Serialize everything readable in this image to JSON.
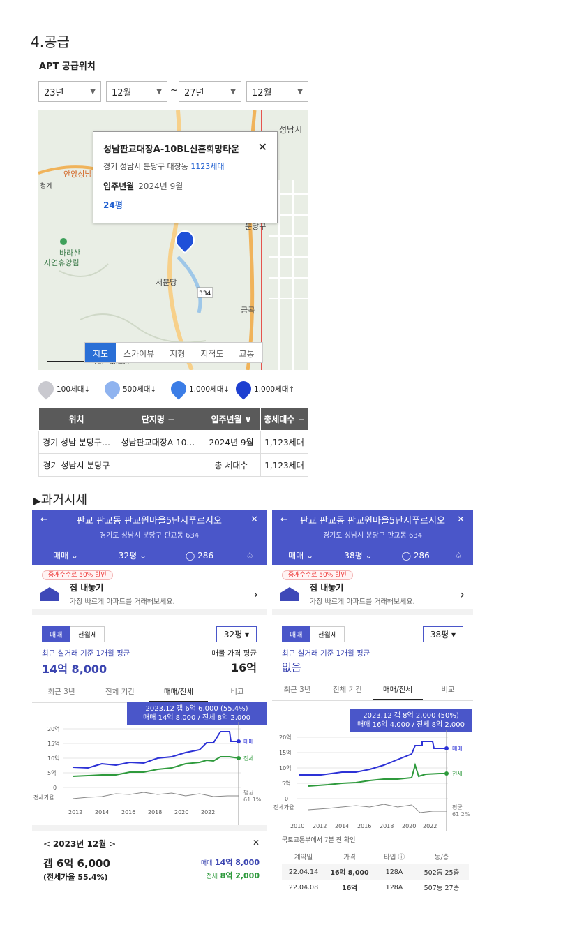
{
  "section1": {
    "title": "4.공급",
    "subtitle": "APT 공급위치"
  },
  "filters": {
    "from_year": "23년",
    "from_month": "12월",
    "tilde": "~",
    "to_year": "27년",
    "to_month": "12월"
  },
  "map": {
    "labels": {
      "seongnam": "성남시",
      "ansung": "안양성남",
      "cheonggye": "청계",
      "barasan": "바라산",
      "forest": "자연휴양림",
      "bundang_gu": "분당구",
      "seobundang": "서분당",
      "route": "334",
      "geumgok": "금곡",
      "scale": "2km",
      "kakao": "Kakao"
    },
    "popup": {
      "title": "성남판교대장A-10BL신혼희망타운",
      "close": "✕",
      "address": "경기 성남시 분당구 대장동",
      "households": "1123세대",
      "move_label": "입주년월",
      "move_value": "2024년 9월",
      "pyeong": "24평"
    },
    "tabs": [
      "지도",
      "스카이뷰",
      "지형",
      "지적도",
      "교통"
    ]
  },
  "legend": [
    "100세대↓",
    "500세대↓",
    "1,000세대↓",
    "1,000세대↑"
  ],
  "supply_table": {
    "headers": [
      "위치",
      "단지명 −",
      "입주년월 ∨",
      "총세대수 −"
    ],
    "rows": [
      [
        "경기 성남 분당구…",
        "성남판교대장A-10…",
        "2024년 9월",
        "1,123세대"
      ],
      [
        "경기 성남시 분당구",
        "",
        "총 세대수",
        "1,123세대"
      ]
    ]
  },
  "section2": {
    "title": "과거시세"
  },
  "left_panel": {
    "back": "←",
    "title": "판교 판교동 판교원마을5단지푸르지오",
    "close": "✕",
    "address": "경기도 성남시 분당구 판교동 634",
    "trade": "매매",
    "pyeong": "32평",
    "comments": "286",
    "promo": "중개수수료 50% 할인",
    "house_title": "집 내놓기",
    "house_sub": "가장 빠르게 아파트를 거래해보세요.",
    "chip_sale": "매매",
    "chip_rent": "전월세",
    "pysel": "32평",
    "avg_label": "최근 실거래 기준 1개월 평균",
    "avg_value": "14억 8,000",
    "ask_label": "매물 가격 평균",
    "ask_value": "16억",
    "tabs": [
      "최근 3년",
      "전체 기간",
      "매매/전세",
      "비교"
    ],
    "tip1": "2023.12  갭 6억 6,000 (55.4%)",
    "tip2": "매매 14억 8,000 / 전세 8억 2,000",
    "yticks": [
      "20억",
      "15억",
      "10억",
      "5억",
      "0"
    ],
    "rate_label": "전세가율",
    "xticks": [
      "2012",
      "2014",
      "2016",
      "2018",
      "2020",
      "2022"
    ],
    "line_sale": "매매",
    "line_jeonse": "전세",
    "rate_tag1": "평균",
    "rate_tag2": "61.1%",
    "month_prev": "<",
    "month": "2023년 12월",
    "month_next": ">",
    "month_close": "✕",
    "gap": "갭 6억 6,000",
    "gap_rate": "(전세가율 55.4%)",
    "sum_sale_l": "매매",
    "sum_sale_v": "14억 8,000",
    "sum_jeonse_l": "전세",
    "sum_jeonse_v": "8억 2,000"
  },
  "right_panel": {
    "back": "←",
    "title": "판교 판교동 판교원마을5단지푸르지오",
    "close": "✕",
    "address": "경기도 성남시 분당구 판교동 634",
    "trade": "매매",
    "pyeong": "38평",
    "comments": "286",
    "promo": "중개수수료 50% 할인",
    "house_title": "집 내놓기",
    "house_sub": "가장 빠르게 아파트를 거래해보세요.",
    "chip_sale": "매매",
    "chip_rent": "전월세",
    "pysel": "38평",
    "avg_label": "최근 실거래 기준 1개월 평균",
    "avg_value": "없음",
    "tabs": [
      "최근 3년",
      "전체 기간",
      "매매/전세",
      "비교"
    ],
    "tip1": "2023.12  갭 8억 2,000 (50%)",
    "tip2": "매매 16억 4,000 / 전세 8억 2,000",
    "yticks": [
      "20억",
      "15억",
      "10억",
      "5억",
      "0"
    ],
    "rate_label": "전세가율",
    "xticks": [
      "2010",
      "2012",
      "2014",
      "2016",
      "2018",
      "2020",
      "2022"
    ],
    "line_sale": "매매",
    "line_jeonse": "전세",
    "rate_tag1": "평균",
    "rate_tag2": "61.2%",
    "source": "국토교통부에서 7분 전 확인",
    "table_headers": [
      "계약일",
      "가격",
      "타입 ⓘ",
      "동/층"
    ],
    "table_rows": [
      [
        "22.04.14",
        "16억 8,000",
        "128A",
        "502동 25층"
      ],
      [
        "22.04.08",
        "16억",
        "128A",
        "507동 27층"
      ]
    ]
  },
  "colors": {
    "header": "#4a56c9",
    "sale": "#2d32d6",
    "jeonse": "#2e9a3c",
    "rate": "#888888"
  }
}
